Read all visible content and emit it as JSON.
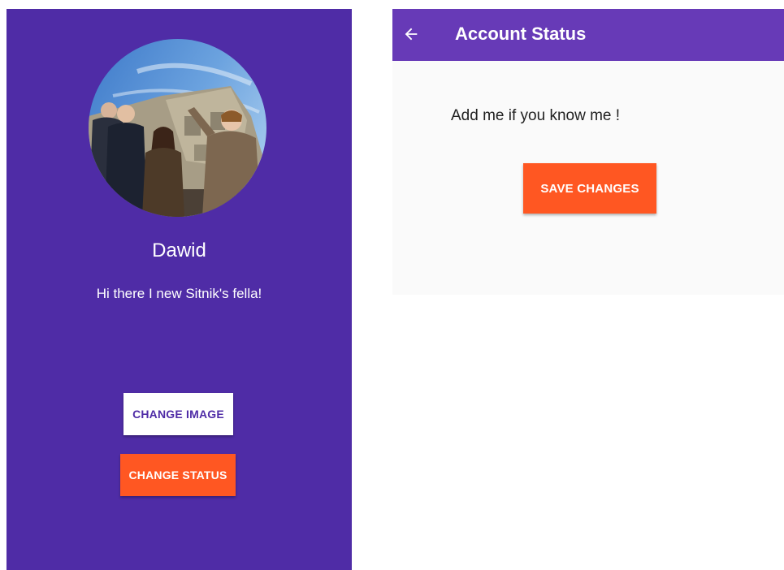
{
  "profile": {
    "display_name": "Dawid",
    "status": "Hi there I new Sitnik's fella!",
    "change_image_label": "CHANGE IMAGE",
    "change_status_label": "CHANGE STATUS",
    "avatar_icon": "profile-photo"
  },
  "status_page": {
    "toolbar_title": "Account Status",
    "back_icon": "arrow-left-icon",
    "status_input_value": "Add me if you know me !",
    "save_label": "SAVE CHANGES"
  },
  "colors": {
    "profile_background": "#4f2ca6",
    "toolbar": "#673ab7",
    "accent": "#ff5722",
    "page_background": "#fafafa"
  }
}
